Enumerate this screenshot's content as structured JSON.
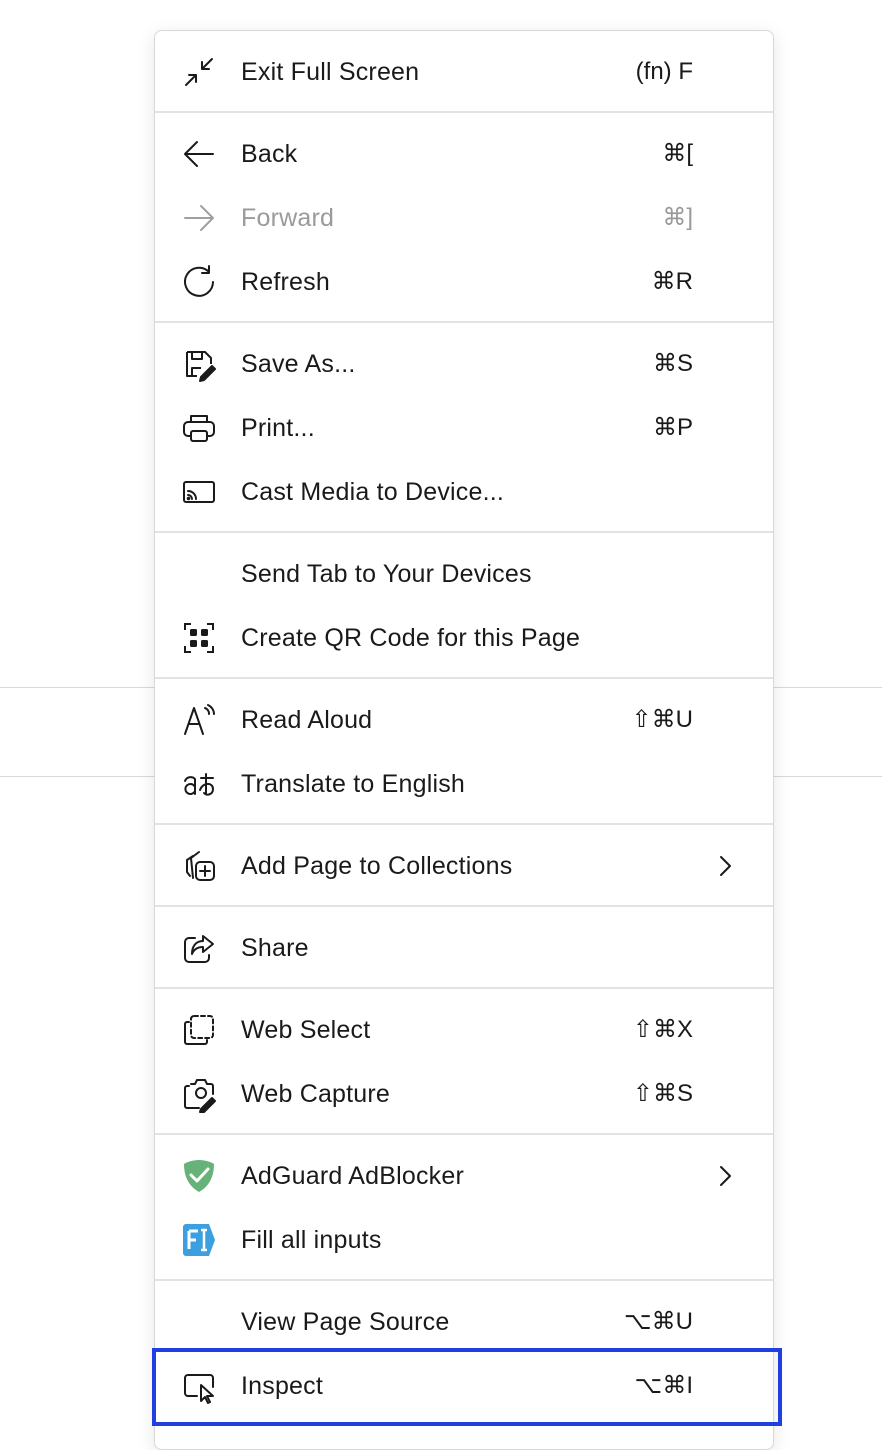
{
  "menu": {
    "exit_full_screen": {
      "label": "Exit Full Screen",
      "shortcut": "(fn) F",
      "icon": "exit-fullscreen-icon"
    },
    "back": {
      "label": "Back",
      "shortcut": "⌘[",
      "icon": "arrow-left-icon"
    },
    "forward": {
      "label": "Forward",
      "shortcut": "⌘]",
      "icon": "arrow-right-icon",
      "disabled": true
    },
    "refresh": {
      "label": "Refresh",
      "shortcut": "⌘R",
      "icon": "refresh-icon"
    },
    "save_as": {
      "label": "Save As...",
      "shortcut": "⌘S",
      "icon": "save-icon"
    },
    "print": {
      "label": "Print...",
      "shortcut": "⌘P",
      "icon": "printer-icon"
    },
    "cast": {
      "label": "Cast Media to Device...",
      "icon": "cast-icon"
    },
    "send_tab": {
      "label": "Send Tab to Your Devices"
    },
    "qr_code": {
      "label": "Create QR Code for this Page",
      "icon": "qr-code-icon"
    },
    "read_aloud": {
      "label": "Read Aloud",
      "shortcut": "⇧⌘U",
      "icon": "read-aloud-icon"
    },
    "translate": {
      "label": "Translate to English",
      "icon": "translate-icon"
    },
    "collections": {
      "label": "Add Page to Collections",
      "icon": "collections-add-icon"
    },
    "share": {
      "label": "Share",
      "icon": "share-icon"
    },
    "web_select": {
      "label": "Web Select",
      "shortcut": "⇧⌘X",
      "icon": "web-select-icon"
    },
    "web_capture": {
      "label": "Web Capture",
      "shortcut": "⇧⌘S",
      "icon": "web-capture-icon"
    },
    "adguard": {
      "label": "AdGuard AdBlocker",
      "icon": "adguard-shield-icon"
    },
    "fill_inputs": {
      "label": "Fill all inputs",
      "icon": "fill-inputs-icon"
    },
    "view_source": {
      "label": "View Page Source",
      "shortcut": "⌥⌘U"
    },
    "inspect": {
      "label": "Inspect",
      "shortcut": "⌥⌘I",
      "icon": "inspect-icon",
      "highlighted": true
    }
  },
  "colors": {
    "highlight_border": "#1f3fe0",
    "adguard_green": "#67b279",
    "fill_inputs_blue": "#3b9fe0",
    "disabled_text": "#9a9a9a"
  }
}
